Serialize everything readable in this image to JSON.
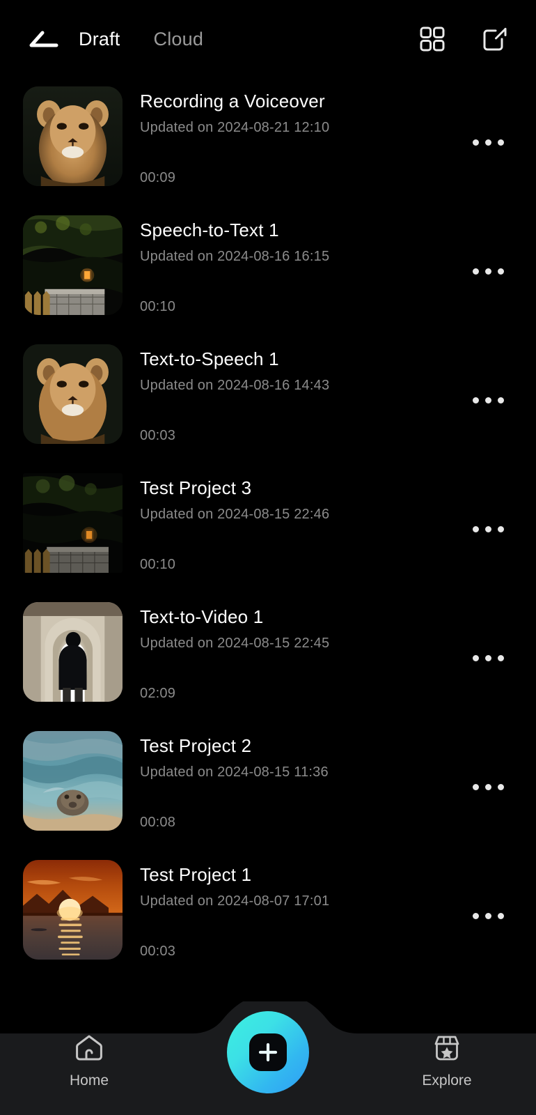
{
  "header": {
    "back_icon": "back-arrow-icon",
    "tabs": [
      {
        "label": "Draft",
        "active": true
      },
      {
        "label": "Cloud",
        "active": false
      }
    ],
    "grid_icon": "grid-view-icon",
    "edit_icon": "edit-square-icon"
  },
  "list": {
    "more_icon": "more-horizontal-icon",
    "subtitle_prefix": "Updated on",
    "items": [
      {
        "title": "Recording a Voiceover",
        "subtitle": "Updated on 2024-08-21 12:10",
        "duration": "00:09",
        "thumb": "lion-portrait"
      },
      {
        "title": "Speech-to-Text 1",
        "subtitle": "Updated on 2024-08-16 16:15",
        "duration": "00:10",
        "thumb": "garden-night-fence"
      },
      {
        "title": "Text-to-Speech 1",
        "subtitle": "Updated on 2024-08-16 14:43",
        "duration": "00:03",
        "thumb": "lion-portrait"
      },
      {
        "title": "Test Project 3",
        "subtitle": "Updated on 2024-08-15 22:46",
        "duration": "00:10",
        "thumb": "garden-night-fence-dark"
      },
      {
        "title": "Text-to-Video 1",
        "subtitle": "Updated on 2024-08-15 22:45",
        "duration": "02:09",
        "thumb": "silhouette-archway"
      },
      {
        "title": "Test Project 2",
        "subtitle": "Updated on 2024-08-15 11:36",
        "duration": "00:08",
        "thumb": "seal-in-water"
      },
      {
        "title": "Test Project 1",
        "subtitle": "Updated on 2024-08-07 17:01",
        "duration": "00:03",
        "thumb": "sunset-over-water"
      }
    ]
  },
  "bottom_nav": {
    "home": {
      "label": "Home",
      "icon": "home-icon"
    },
    "create": {
      "label": "",
      "icon": "plus-icon"
    },
    "explore": {
      "label": "Explore",
      "icon": "explore-store-icon"
    }
  },
  "colors": {
    "background": "#000000",
    "nav_background": "#1a1b1d",
    "accent_start": "#3df0df",
    "accent_end": "#2f9df5",
    "text_primary": "#ffffff",
    "text_secondary": "#8b8b8b",
    "tab_inactive": "#9b9b9b"
  }
}
